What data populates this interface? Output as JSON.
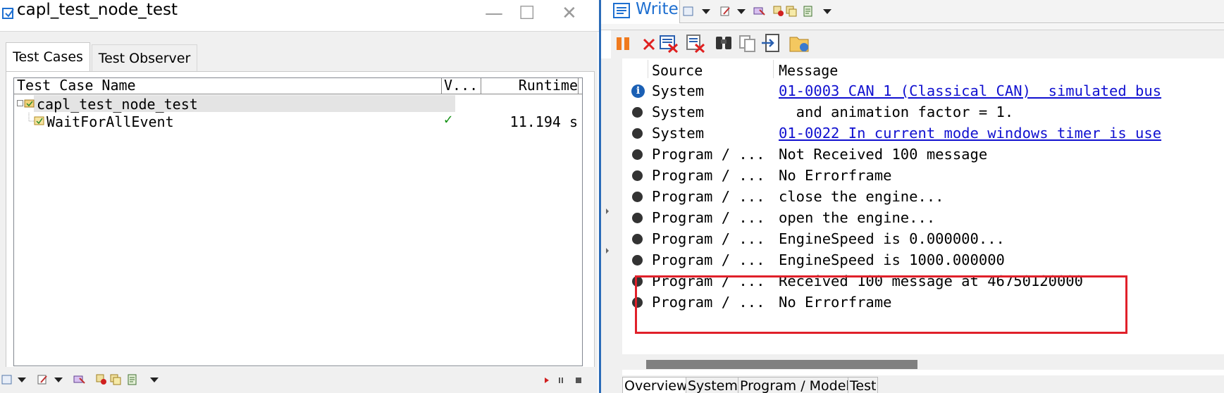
{
  "left_window": {
    "title": "capl_test_node_test",
    "controls": {
      "minimize": "—",
      "maximize": "☐",
      "close": "✕"
    },
    "tabs": [
      {
        "label": "Test Cases",
        "active": true
      },
      {
        "label": "Test Observer",
        "active": false
      }
    ],
    "tree": {
      "columns": {
        "name": "Test Case Name",
        "verdict": "V...",
        "runtime": "Runtime"
      },
      "rows": [
        {
          "name": "capl_test_node_test",
          "verdict": "",
          "runtime": "",
          "selected": true
        },
        {
          "name": "WaitForAllEvent",
          "verdict": "✓",
          "runtime": "11.194 s"
        }
      ]
    }
  },
  "right_window": {
    "title": "Write",
    "columns": {
      "source": "Source",
      "message": "Message"
    },
    "messages": [
      {
        "icon": "info-icon",
        "source": "System",
        "message": "01-0003 CAN 1 (Classical CAN)  simulated bus",
        "link": true
      },
      {
        "icon": "dot-icon",
        "source": "System",
        "message": "  and animation factor = 1.",
        "link": false
      },
      {
        "icon": "dot-icon",
        "source": "System",
        "message": "01-0022 In current mode windows timer is use",
        "link": true
      },
      {
        "icon": "dot-icon",
        "source": "Program / ...",
        "message": "Not Received 100 message",
        "link": false
      },
      {
        "icon": "dot-icon",
        "source": "Program / ...",
        "message": "No Errorframe",
        "link": false
      },
      {
        "icon": "dot-icon",
        "source": "Program / ...",
        "message": "close the engine...",
        "link": false
      },
      {
        "icon": "dot-icon",
        "source": "Program / ...",
        "message": "open the engine...",
        "link": false
      },
      {
        "icon": "dot-icon",
        "source": "Program / ...",
        "message": "EngineSpeed is 0.000000...",
        "link": false
      },
      {
        "icon": "dot-icon",
        "source": "Program / ...",
        "message": "EngineSpeed is 1000.000000",
        "link": false
      },
      {
        "icon": "dot-icon",
        "source": "Program / ...",
        "message": "Received 100 message at 46750120000",
        "link": false
      },
      {
        "icon": "dot-icon",
        "source": "Program / ...",
        "message": "No Errorframe",
        "link": false
      }
    ],
    "bottom_tabs": [
      "Overview",
      "System",
      "Program / Model",
      "Test"
    ]
  },
  "colors": {
    "highlight": "#e0202a",
    "link": "#1010d0",
    "divider": "#2b6bb8",
    "title_accent": "#1e6fd0"
  }
}
